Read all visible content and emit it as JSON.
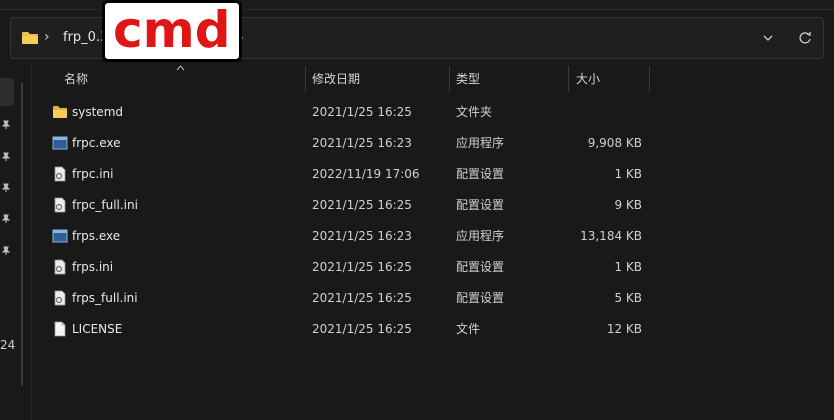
{
  "address": {
    "path": "frp_0.35.1_windows_amd64",
    "overlay_text": "cmd"
  },
  "nav": {
    "fragment": "24"
  },
  "columns": {
    "name": "名称",
    "date": "修改日期",
    "type": "类型",
    "size": "大小"
  },
  "files": [
    {
      "name": "systemd",
      "date": "2021/1/25 16:25",
      "type": "文件夹",
      "size": "",
      "icon": "folder-icon"
    },
    {
      "name": "frpc.exe",
      "date": "2021/1/25 16:23",
      "type": "应用程序",
      "size": "9,908 KB",
      "icon": "exe-icon"
    },
    {
      "name": "frpc.ini",
      "date": "2022/11/19 17:06",
      "type": "配置设置",
      "size": "1 KB",
      "icon": "ini-file-icon"
    },
    {
      "name": "frpc_full.ini",
      "date": "2021/1/25 16:25",
      "type": "配置设置",
      "size": "9 KB",
      "icon": "ini-file-icon"
    },
    {
      "name": "frps.exe",
      "date": "2021/1/25 16:23",
      "type": "应用程序",
      "size": "13,184 KB",
      "icon": "exe-icon"
    },
    {
      "name": "frps.ini",
      "date": "2021/1/25 16:25",
      "type": "配置设置",
      "size": "1 KB",
      "icon": "ini-file-icon"
    },
    {
      "name": "frps_full.ini",
      "date": "2021/1/25 16:25",
      "type": "配置设置",
      "size": "5 KB",
      "icon": "ini-file-icon"
    },
    {
      "name": "LICENSE",
      "date": "2021/1/25 16:25",
      "type": "文件",
      "size": "12 KB",
      "icon": "blank-file-icon"
    }
  ],
  "colors": {
    "background": "#191919",
    "folder": "#f0c04a",
    "overlay_text": "#e01616"
  }
}
